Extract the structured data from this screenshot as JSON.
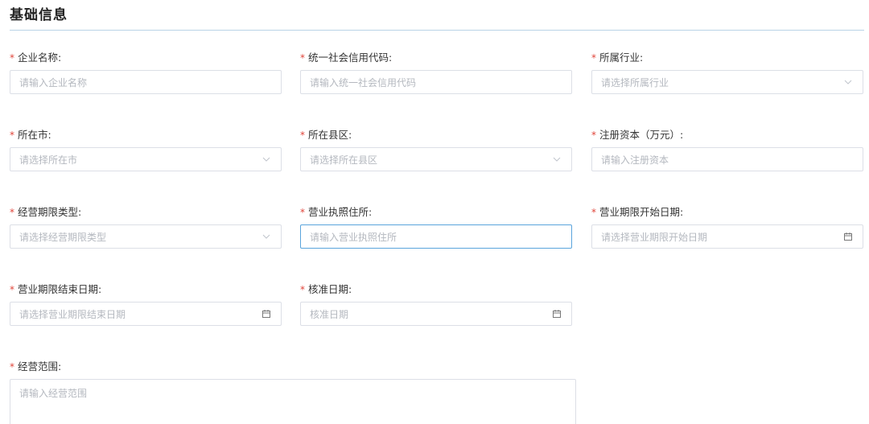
{
  "section": {
    "title": "基础信息"
  },
  "colors": {
    "required": "#e0453a",
    "focus_border": "#5aa4dc",
    "divider": "#b9d3e6"
  },
  "fields": {
    "company_name": {
      "label": "企业名称:",
      "placeholder": "请输入企业名称",
      "type": "input"
    },
    "credit_code": {
      "label": "统一社会信用代码:",
      "placeholder": "请输入统一社会信用代码",
      "type": "input"
    },
    "industry": {
      "label": "所属行业:",
      "placeholder": "请选择所属行业",
      "type": "select",
      "icon": "chevron-down-icon"
    },
    "city": {
      "label": "所在市:",
      "placeholder": "请选择所在市",
      "type": "select",
      "icon": "chevron-down-icon"
    },
    "county": {
      "label": "所在县区:",
      "placeholder": "请选择所在县区",
      "type": "select",
      "icon": "chevron-down-icon"
    },
    "capital": {
      "label": "注册资本（万元）:",
      "placeholder": "请输入注册资本",
      "type": "input"
    },
    "term_type": {
      "label": "经营期限类型:",
      "placeholder": "请选择经营期限类型",
      "type": "select",
      "icon": "chevron-down-icon"
    },
    "license_address": {
      "label": "营业执照住所:",
      "placeholder": "请输入营业执照住所",
      "type": "input",
      "focused": true
    },
    "term_start": {
      "label": "营业期限开始日期:",
      "placeholder": "请选择营业期限开始日期",
      "type": "date",
      "icon": "calendar-icon"
    },
    "term_end": {
      "label": "营业期限结束日期:",
      "placeholder": "请选择营业期限结束日期",
      "type": "date",
      "icon": "calendar-icon"
    },
    "approval_date": {
      "label": "核准日期:",
      "placeholder": "核准日期",
      "type": "date",
      "icon": "calendar-icon"
    },
    "business_scope": {
      "label": "经营范围:",
      "placeholder": "请输入经营范围",
      "type": "textarea"
    }
  },
  "required_mark": "*"
}
